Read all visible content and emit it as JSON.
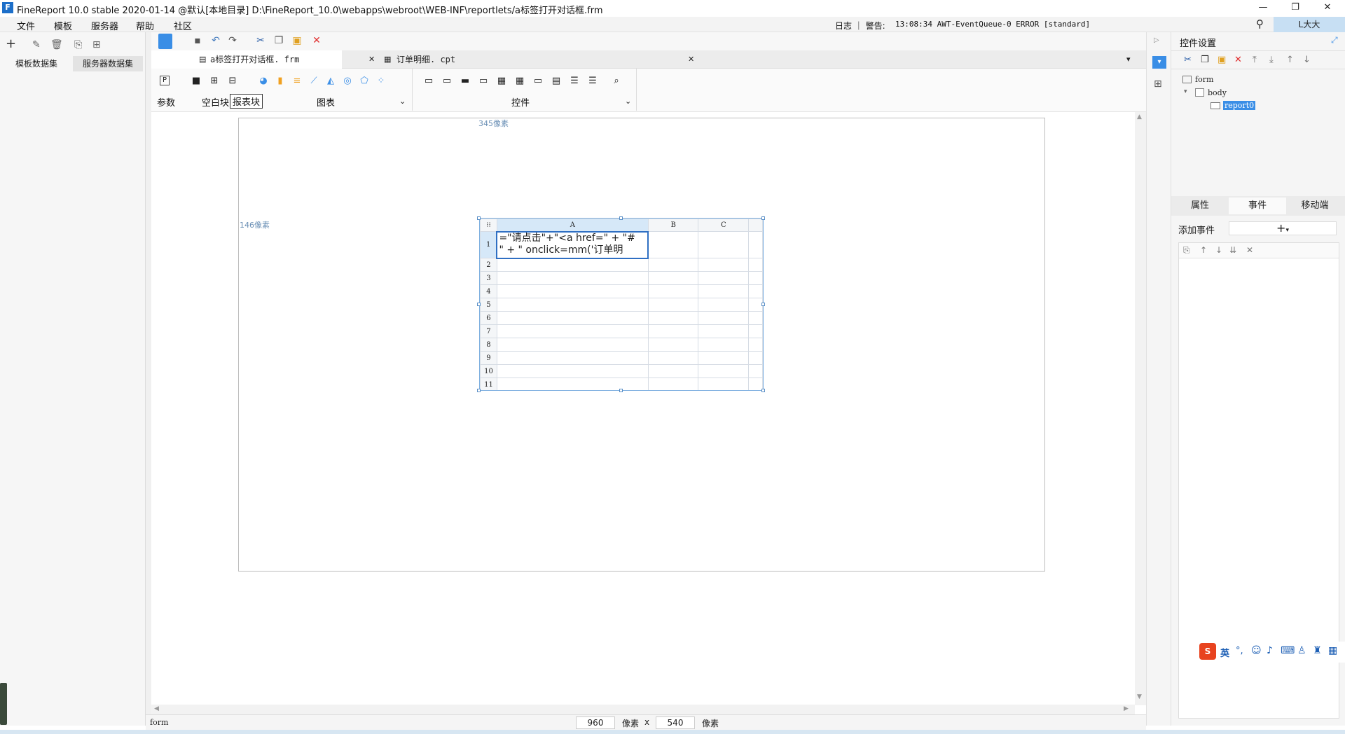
{
  "window": {
    "title": "FineReport 10.0 stable 2020-01-14 @默认[本地目录]    D:\\FineReport_10.0\\webapps\\webroot\\WEB-INF\\reportlets/a标签打开对话框.frm",
    "logo": "F",
    "minimize": "—",
    "restore": "❐",
    "close": "✕"
  },
  "menu": {
    "items": [
      "文件",
      "模板",
      "服务器",
      "帮助",
      "社区"
    ],
    "log_label": "日志 ｜ 警告:",
    "warning": "13:08:34 AWT-EventQueue-0 ERROR [standard]",
    "search_icon": "⚲",
    "user": "L大大"
  },
  "left_panel": {
    "tabs": [
      "模板数据集",
      "服务器数据集"
    ],
    "tools": [
      "+",
      "✎",
      "🗑",
      "⎘",
      "⊞"
    ]
  },
  "file_tabs": [
    {
      "label": "a标签打开对话框. frm",
      "close": "✕"
    },
    {
      "label": "订单明细. cpt",
      "close": "✕"
    }
  ],
  "widget_bar": {
    "param_label": "参数",
    "blank_label": "空白块",
    "report_block_label": "报表块",
    "chart_label": "图表",
    "widget_label": "控件"
  },
  "canvas": {
    "top_dim": "345像素",
    "left_dim": "146像素",
    "columns": [
      "A",
      "B",
      "C"
    ],
    "rows": [
      "1",
      "2",
      "3",
      "4",
      "5",
      "6",
      "7",
      "8",
      "9",
      "10",
      "11"
    ],
    "cell_a1_line1": "=\"请点击\"+\"<a href=\" + \"#",
    "cell_a1_line2": "\" + \" onclick=mm('订单明"
  },
  "status": {
    "mode": "form",
    "width": "960",
    "width_unit": "像素",
    "times": "x",
    "height": "540",
    "height_unit": "像素"
  },
  "right_panel": {
    "title": "控件设置",
    "tree": [
      "form",
      "body",
      "report0"
    ],
    "tabs": [
      "属性",
      "事件",
      "移动端"
    ],
    "add_event_label": "添加事件",
    "add_icon": "+"
  },
  "ime": {
    "label": "英"
  }
}
